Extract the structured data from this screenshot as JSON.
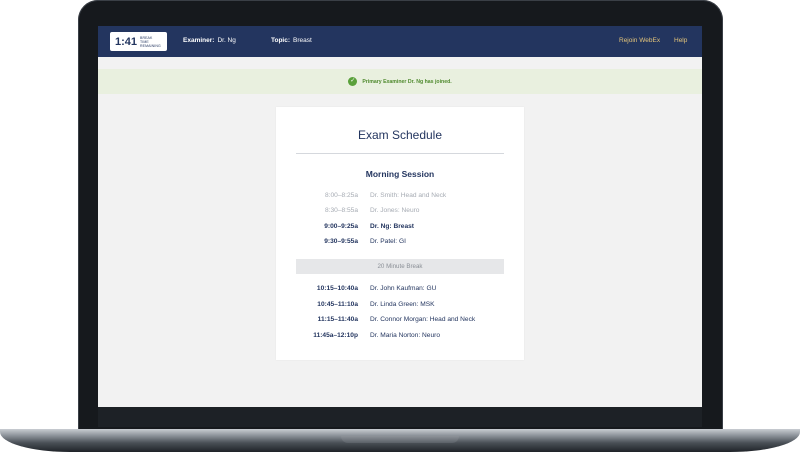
{
  "timer": {
    "time": "1:41",
    "caption": "BREAK TIME REMAINING"
  },
  "header": {
    "examiner_label": "Examiner:",
    "examiner_value": "Dr. Ng",
    "topic_label": "Topic:",
    "topic_value": "Breast",
    "rejoin_label": "Rejoin WebEx",
    "help_label": "Help"
  },
  "notice": {
    "icon": "check-circle-icon",
    "text": "Primary Examiner Dr. Ng has joined."
  },
  "schedule": {
    "title": "Exam Schedule",
    "session_title": "Morning Session",
    "morning": [
      {
        "time": "8:00–8:25a",
        "exam": "Dr. Smith: Head and Neck",
        "status": "past"
      },
      {
        "time": "8:30–8:55a",
        "exam": "Dr. Jones: Neuro",
        "status": "past"
      },
      {
        "time": "9:00–9:25a",
        "exam": "Dr. Ng: Breast",
        "status": "current"
      },
      {
        "time": "9:30–9:55a",
        "exam": "Dr. Patel: GI",
        "status": "upcoming"
      }
    ],
    "break_label": "20 Minute Break",
    "after_break": [
      {
        "time": "10:15–10:40a",
        "exam": "Dr. John Kaufman: GU",
        "status": "upcoming"
      },
      {
        "time": "10:45–11:10a",
        "exam": "Dr. Linda Green: MSK",
        "status": "upcoming"
      },
      {
        "time": "11:15–11:40a",
        "exam": "Dr. Connor Morgan: Head and Neck",
        "status": "upcoming"
      },
      {
        "time": "11:45a–12:10p",
        "exam": "Dr. Maria Norton: Neuro",
        "status": "upcoming"
      }
    ]
  },
  "colors": {
    "navy": "#23355f",
    "gold_link": "#e3c47a",
    "success_green": "#5aa13b",
    "notice_bg": "#e9f0df",
    "past_text": "#a6abb3"
  }
}
